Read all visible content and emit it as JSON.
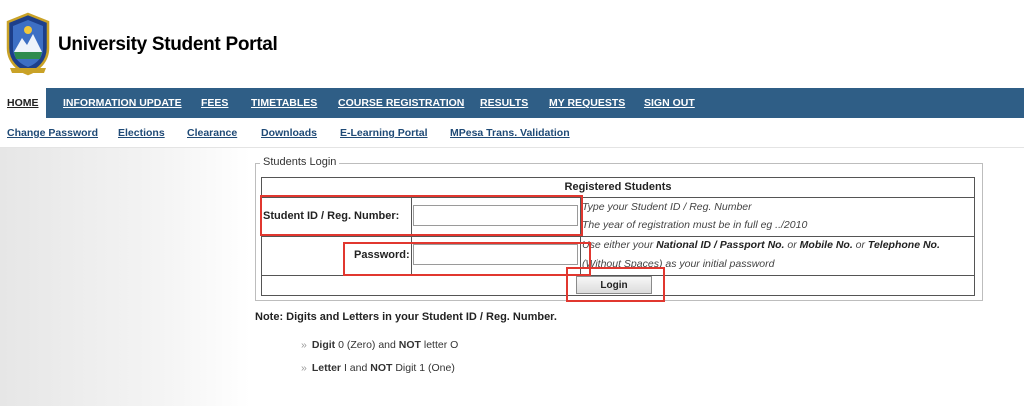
{
  "header": {
    "title": "University Student Portal",
    "logo_icon": "university-crest-icon"
  },
  "main_nav": {
    "items": [
      {
        "label": "HOME",
        "active": true
      },
      {
        "label": "INFORMATION UPDATE"
      },
      {
        "label": "FEES"
      },
      {
        "label": "TIMETABLES"
      },
      {
        "label": "COURSE REGISTRATION"
      },
      {
        "label": "RESULTS"
      },
      {
        "label": "MY REQUESTS"
      },
      {
        "label": "SIGN OUT"
      }
    ]
  },
  "sub_nav": {
    "items": [
      {
        "label": "Change Password"
      },
      {
        "label": "Elections"
      },
      {
        "label": "Clearance"
      },
      {
        "label": "Downloads"
      },
      {
        "label": "E-Learning Portal"
      },
      {
        "label": "MPesa Trans. Validation"
      }
    ]
  },
  "login": {
    "legend": "Students Login",
    "table_title": "Registered Students",
    "student_id": {
      "label": "Student ID / Reg. Number:",
      "value": "",
      "hint_1": "Type your Student ID / Reg. Number",
      "hint_2": "The year of registration must be in full eg ../2010"
    },
    "password": {
      "label": "Password:",
      "value": "",
      "hint_prefix": "Use either your ",
      "hint_bold_1": "National ID / Passport No.",
      "hint_or_1": " or ",
      "hint_bold_2": "Mobile No.",
      "hint_or_2": " or ",
      "hint_bold_3": "Telephone No.",
      "hint_line2": "(Without Spaces) as your initial password"
    },
    "button_label": "Login"
  },
  "notes": {
    "heading": "Note: Digits and Letters in your Student ID / Reg. Number.",
    "bullet_glyph": "»",
    "items": [
      {
        "bold_1": "Digit",
        "text_1": " 0 (Zero) and ",
        "bold_2": "NOT",
        "text_2": " letter O"
      },
      {
        "bold_1": "Letter",
        "text_1": " I and ",
        "bold_2": "NOT",
        "text_2": " Digit 1 (One)"
      }
    ]
  },
  "colors": {
    "nav_bg": "#2f5e86",
    "link": "#1f4a76",
    "highlight": "#e1372f"
  }
}
